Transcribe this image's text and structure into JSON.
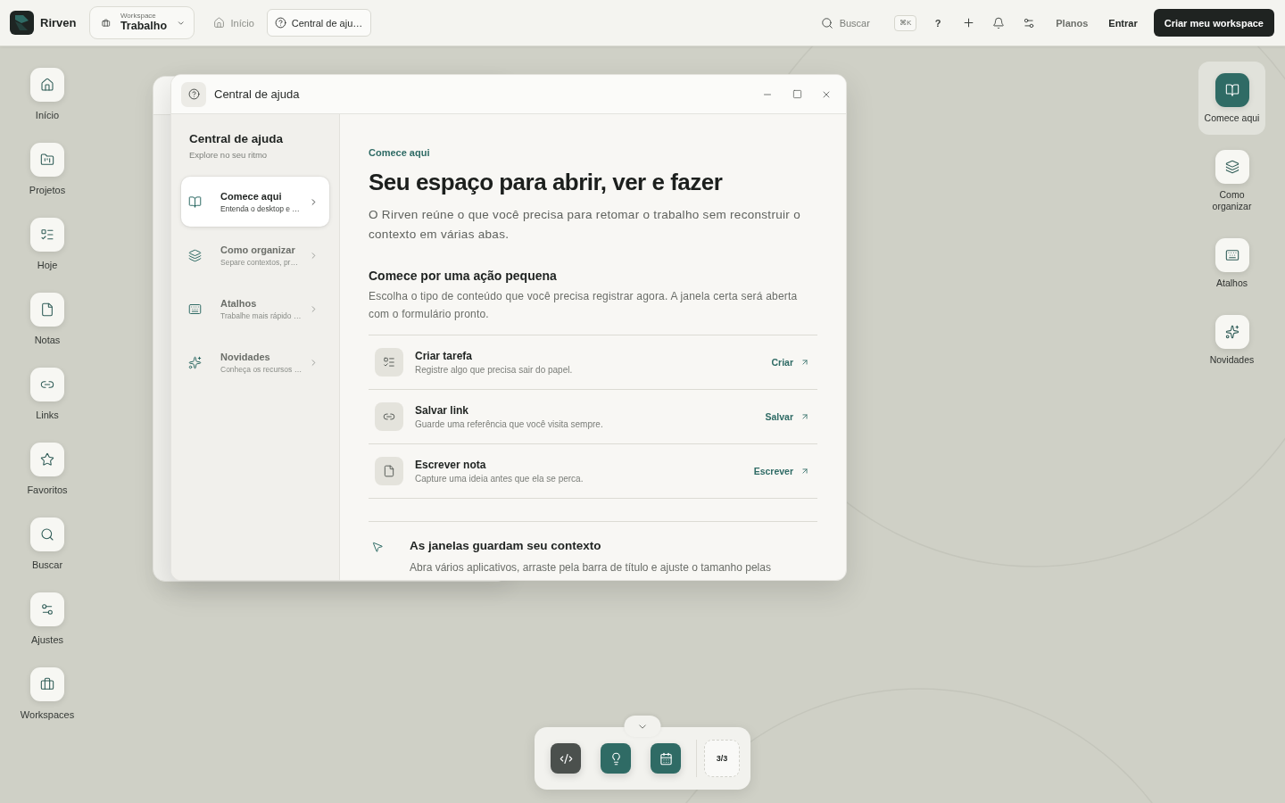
{
  "top_bar": {
    "brand": "Rirven",
    "workspace": {
      "label": "Workspace",
      "value": "Trabalho"
    },
    "tabs": [
      {
        "label": "Início",
        "selected": false
      },
      {
        "label": "Central de aju…",
        "selected": true
      }
    ],
    "search": {
      "label": "Buscar"
    },
    "shortcut": "⌘K",
    "help": "?",
    "links": [
      {
        "label": "Planos"
      },
      {
        "label": "Entrar"
      }
    ],
    "primary_button": "Criar meu workspace"
  },
  "left_dock": [
    {
      "label": "Início"
    },
    {
      "label": "Projetos"
    },
    {
      "label": "Hoje"
    },
    {
      "label": "Notas"
    },
    {
      "label": "Links"
    },
    {
      "label": "Favoritos"
    },
    {
      "label": "Buscar"
    },
    {
      "label": "Ajustes"
    },
    {
      "label": "Workspaces"
    }
  ],
  "window": {
    "title": "Central de ajuda",
    "sidebar": {
      "title": "Central de ajuda",
      "subtitle": "Explore no seu ritmo",
      "items": [
        {
          "title": "Comece aqui",
          "subtitle": "Entenda o desktop e …",
          "selected": true
        },
        {
          "title": "Como organizar",
          "subtitle": "Separe contextos, pr…",
          "selected": false
        },
        {
          "title": "Atalhos",
          "subtitle": "Trabalhe mais rápido …",
          "selected": false
        },
        {
          "title": "Novidades",
          "subtitle": "Conheça os recursos …",
          "selected": false
        }
      ]
    },
    "content": {
      "eyebrow": "Comece aqui",
      "heading": "Seu espaço para abrir, ver e fazer",
      "intro": "O Rirven reúne o que você precisa para retomar o trabalho sem reconstruir o contexto em várias abas.",
      "section": {
        "title": "Comece por uma ação pequena",
        "text": "Escolha o tipo de conteúdo que você precisa registrar agora. A janela certa será aberta com o formulário pronto."
      },
      "actions": [
        {
          "title": "Criar tarefa",
          "description": "Registre algo que precisa sair do papel.",
          "link": "Criar"
        },
        {
          "title": "Salvar link",
          "description": "Guarde uma referência que você visita sempre.",
          "link": "Salvar"
        },
        {
          "title": "Escrever nota",
          "description": "Capture uma ideia antes que ela se perca.",
          "link": "Escrever"
        }
      ],
      "tip": {
        "title": "As janelas guardam seu contexto",
        "text": "Abra vários aplicativos, arraste pela barra de título e ajuste o tamanho pelas"
      }
    }
  },
  "right_dock": [
    {
      "label": "Comece aqui",
      "selected": true
    },
    {
      "label": "Como organizar",
      "selected": false
    },
    {
      "label": "Atalhos",
      "selected": false
    },
    {
      "label": "Novidades",
      "selected": false
    }
  ],
  "bottom_dock": {
    "apps": [
      {
        "color": "#4b504d"
      },
      {
        "color": "#2f6b65"
      },
      {
        "color": "#2f6b65"
      }
    ],
    "counter": "3/3"
  }
}
